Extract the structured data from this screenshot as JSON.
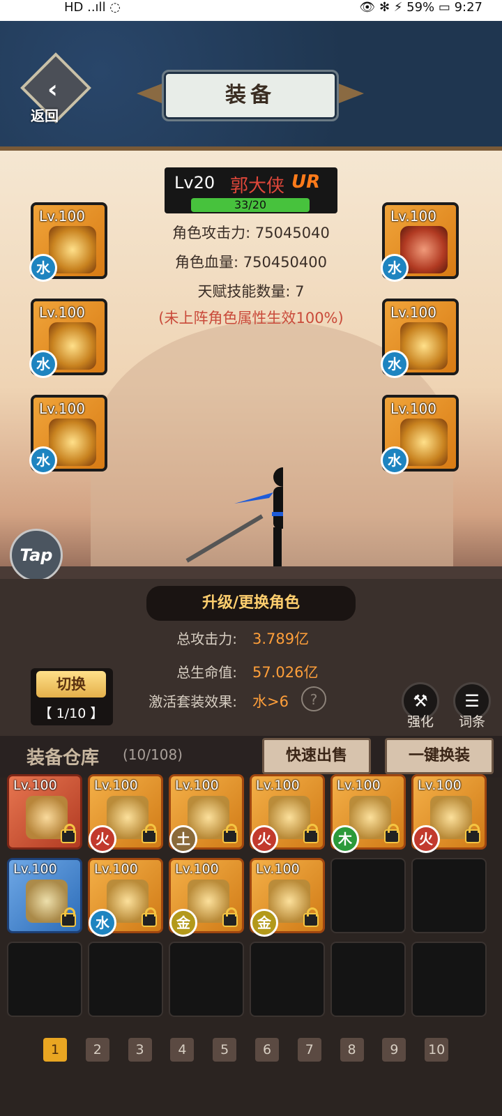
{
  "status_bar": {
    "left": "HD ..ıll ◌",
    "right": "👁 ✻ ⚡ 59% ▭ 9:27"
  },
  "header": {
    "back_label": "返回",
    "title": "装备"
  },
  "character": {
    "level": "Lv20",
    "name": "郭大侠",
    "rarity": "UR",
    "progress_text": "33/20",
    "stats": [
      "角色攻击力: 75045040",
      "角色血量: 750450400",
      "天赋技能数量: 7"
    ],
    "note": "(未上阵角色属性生效100%)"
  },
  "equipped": {
    "left": [
      {
        "level": "Lv.100",
        "element": "水",
        "icon": "golden-sword-icon"
      },
      {
        "level": "Lv.100",
        "element": "水",
        "icon": "golden-helmet-icon"
      },
      {
        "level": "Lv.100",
        "element": "水",
        "icon": "amulet-icon"
      }
    ],
    "right": [
      {
        "level": "Lv.100",
        "element": "水",
        "icon": "red-armor-icon"
      },
      {
        "level": "Lv.100",
        "element": "水",
        "icon": "boots-icon"
      },
      {
        "level": "Lv.100",
        "element": "水",
        "icon": "ring-icon"
      }
    ]
  },
  "tap_label": "Tap",
  "upgrade_button": "升级/更换角色",
  "totals": {
    "attack_label": "总攻击力:",
    "attack_value": "3.789亿",
    "hp_label": "总生命值:",
    "hp_value": "57.026亿",
    "set_label": "激活套装效果:",
    "set_value": "水>6",
    "help": "?"
  },
  "switch": {
    "label": "切换",
    "page": "【 1/10 】"
  },
  "tools": {
    "strengthen_label": "强化",
    "entries_label": "词条"
  },
  "warehouse": {
    "title": "装备仓库",
    "count": "(10/108)",
    "quick_sell": "快速出售",
    "one_key_equip": "一键换装",
    "items": [
      {
        "level": "Lv.100",
        "element": "",
        "style": "red",
        "icon": "red-sword-icon"
      },
      {
        "level": "Lv.100",
        "element": "火",
        "style": "orange",
        "icon": "blue-blade-icon"
      },
      {
        "level": "Lv.100",
        "element": "土",
        "style": "orange",
        "icon": "golden-sword-icon"
      },
      {
        "level": "Lv.100",
        "element": "火",
        "style": "orange",
        "icon": "purple-sword-icon"
      },
      {
        "level": "Lv.100",
        "element": "木",
        "style": "orange",
        "icon": "purple-sword-icon"
      },
      {
        "level": "Lv.100",
        "element": "火",
        "style": "orange",
        "icon": "golden-sword-icon"
      },
      {
        "level": "Lv.100",
        "element": "",
        "style": "blue",
        "icon": "silver-armor-icon"
      },
      {
        "level": "Lv.100",
        "element": "水",
        "style": "orange",
        "icon": "amulet-icon"
      },
      {
        "level": "Lv.100",
        "element": "金",
        "style": "orange",
        "icon": "purple-armor-icon"
      },
      {
        "level": "Lv.100",
        "element": "金",
        "style": "orange",
        "icon": "amulet-icon"
      }
    ]
  },
  "pages": [
    "1",
    "2",
    "3",
    "4",
    "5",
    "6",
    "7",
    "8",
    "9",
    "10"
  ]
}
